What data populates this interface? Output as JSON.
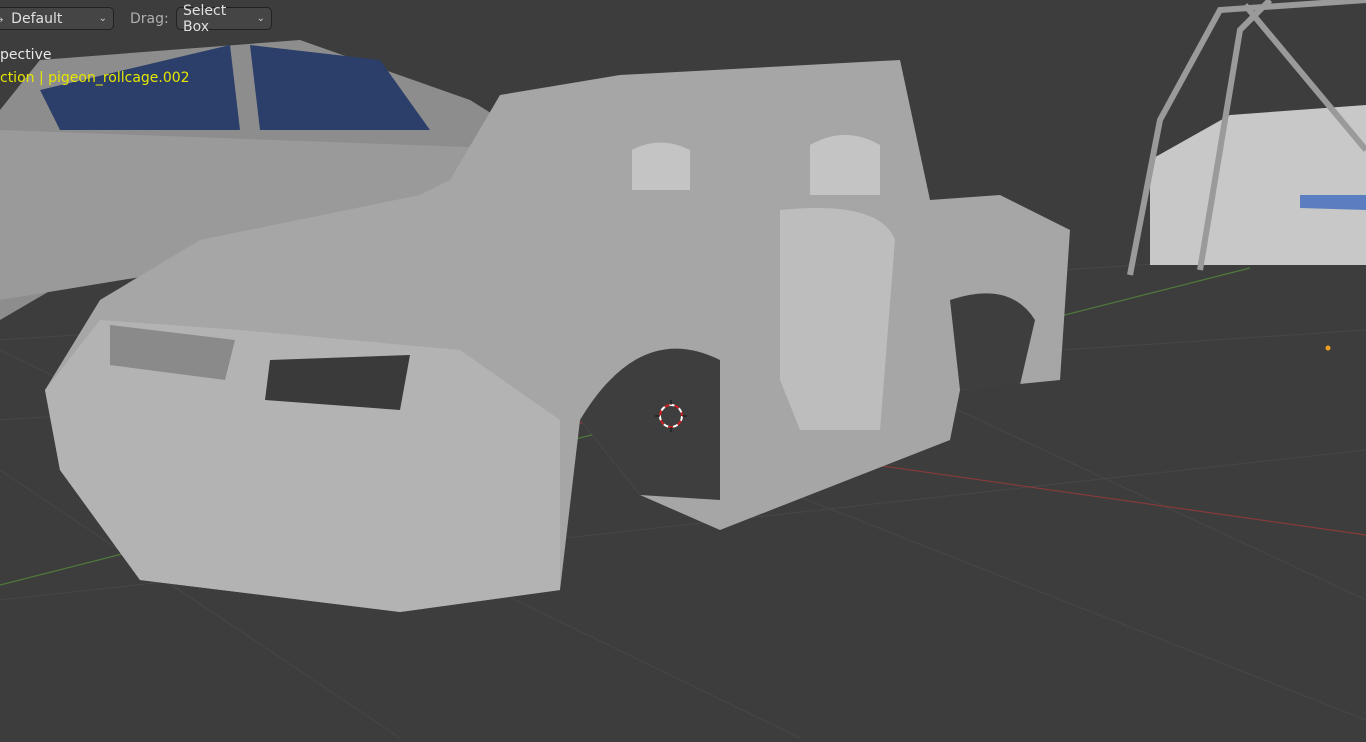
{
  "header": {
    "orientation_value": "Default",
    "drag_label": "Drag:",
    "drag_value": "Select Box"
  },
  "overlay": {
    "view_name": "pective",
    "selection_text": "ction | pigeon_rollcage.002"
  },
  "colors": {
    "background": "#3d3d3d",
    "overlay_text": "#e6e600",
    "x_axis": "#8a3a3a",
    "y_axis": "#4e7a3a"
  }
}
